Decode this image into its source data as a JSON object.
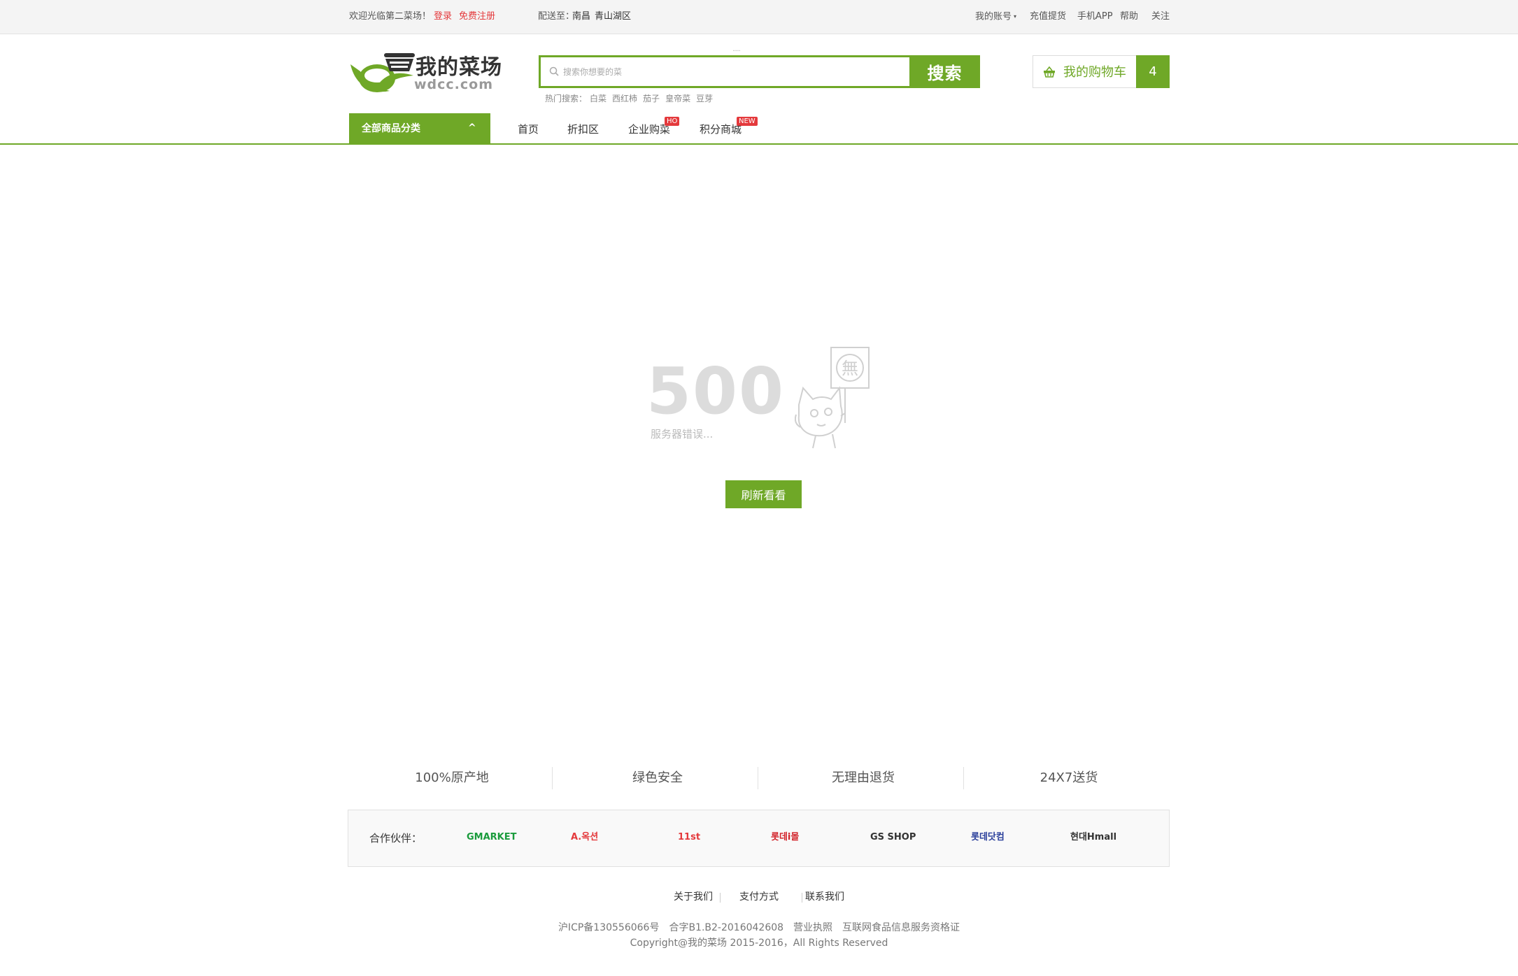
{
  "topbar": {
    "welcome": "欢迎光临第二菜场！",
    "login": "登录",
    "register": "免费注册",
    "delivery_label": "配送至：",
    "delivery_city": "南昌",
    "delivery_district": "青山湖区",
    "my_account": "我的账号",
    "recharge": "充值提货",
    "mobile_app": "手机APP",
    "help": "帮助",
    "follow": "关注"
  },
  "header": {
    "logo_title": "我的菜场",
    "logo_sub": "wdcc.com",
    "search_placeholder": "搜索你想要的菜",
    "search_button": "搜索",
    "hot_label": "热门搜索：",
    "hot_terms": [
      "白菜",
      "西红柿",
      "茄子",
      "皇帝菜",
      "豆芽"
    ],
    "cart_label": "我的购物车",
    "cart_count": "4"
  },
  "nav": {
    "categories": "全部商品分类",
    "chevron": "^",
    "items": [
      {
        "label": "首页"
      },
      {
        "label": "折扣区"
      },
      {
        "label": "企业购菜",
        "badge": "HO"
      },
      {
        "label": "积分商城",
        "badge": "NEW"
      }
    ]
  },
  "error": {
    "code": "500",
    "message": "服务器错误...",
    "sign_char": "無",
    "refresh_button": "刷新看看"
  },
  "features": [
    "100%原产地",
    "绿色安全",
    "无理由退货",
    "24X7送货"
  ],
  "partners": {
    "label": "合作伙伴：",
    "logos": [
      {
        "name": "Gmarket",
        "text": "GMARKET",
        "color": "#1a9b3c"
      },
      {
        "name": "Auction",
        "text": "A.옥션",
        "color": "#e4393c"
      },
      {
        "name": "11st",
        "text": "11st",
        "color": "#e4393c"
      },
      {
        "name": "Lotte i mall",
        "text": "롯데i몰",
        "color": "#d2232a"
      },
      {
        "name": "GS SHOP",
        "text": "GS SHOP",
        "color": "#333333"
      },
      {
        "name": "Lotte Dotcom",
        "text": "롯데닷컴",
        "color": "#2a3f9b"
      },
      {
        "name": "Hmall",
        "text": "현대Hmall",
        "color": "#333333"
      }
    ]
  },
  "footer": {
    "links": [
      "关于我们",
      "支付方式",
      "联系我们"
    ],
    "license_line": "沪ICP备130556066号　合字B1.B2-2016042608　营业执照　互联网食品信息服务资格证",
    "copyright": "Copyright@我的菜场 2015-2016，All Rights Reserved"
  },
  "colors": {
    "brand_green": "#6fa827",
    "alert_red": "#e4393c",
    "muted_gray": "#dcdcdc"
  },
  "icons": [
    "search-icon",
    "basket-icon",
    "logo-basket-icon",
    "cat-holding-sign-icon"
  ]
}
